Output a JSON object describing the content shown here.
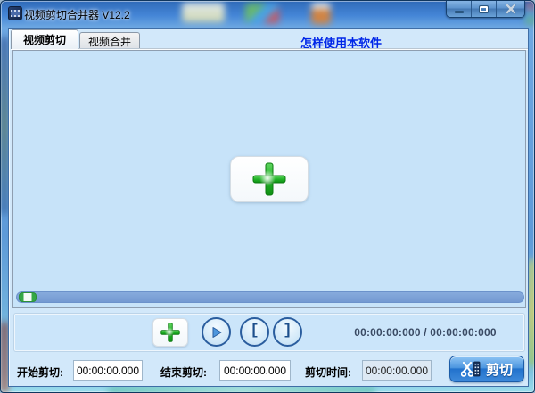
{
  "window": {
    "title": "视频剪切合并器 V12.2"
  },
  "tabs": {
    "cut": "视频剪切",
    "merge": "视频合并"
  },
  "help_link": "怎样使用本软件",
  "toolbar": {
    "time_display": "00:00:00:000 / 00:00:00:000",
    "mark_in_glyph": "[",
    "mark_out_glyph": "]"
  },
  "cut_form": {
    "start_label": "开始剪切:",
    "start_value": "00:00:00.000",
    "end_label": "结束剪切:",
    "end_value": "00:00:00.000",
    "duration_label": "剪切时间:",
    "duration_value": "00:00:00.000",
    "cut_button": "剪切"
  },
  "icons": {
    "titlebar": [
      "minimize-icon",
      "maximize-icon",
      "close-icon"
    ],
    "preview": "add-video-plus-icon",
    "player": [
      "add-plus-icon",
      "play-icon",
      "bracket-open-icon",
      "bracket-close-icon"
    ],
    "cut_button": "scissors-film-icon"
  },
  "colors": {
    "titlebar_glass": "#4485d6",
    "client_background": "#d2e8fa",
    "panel_background": "#c7e3f9",
    "slider_track": "#7ba0d6",
    "plus_green": "#22b428",
    "link_blue": "#0026e8",
    "cut_button_blue": "#2272cc"
  }
}
